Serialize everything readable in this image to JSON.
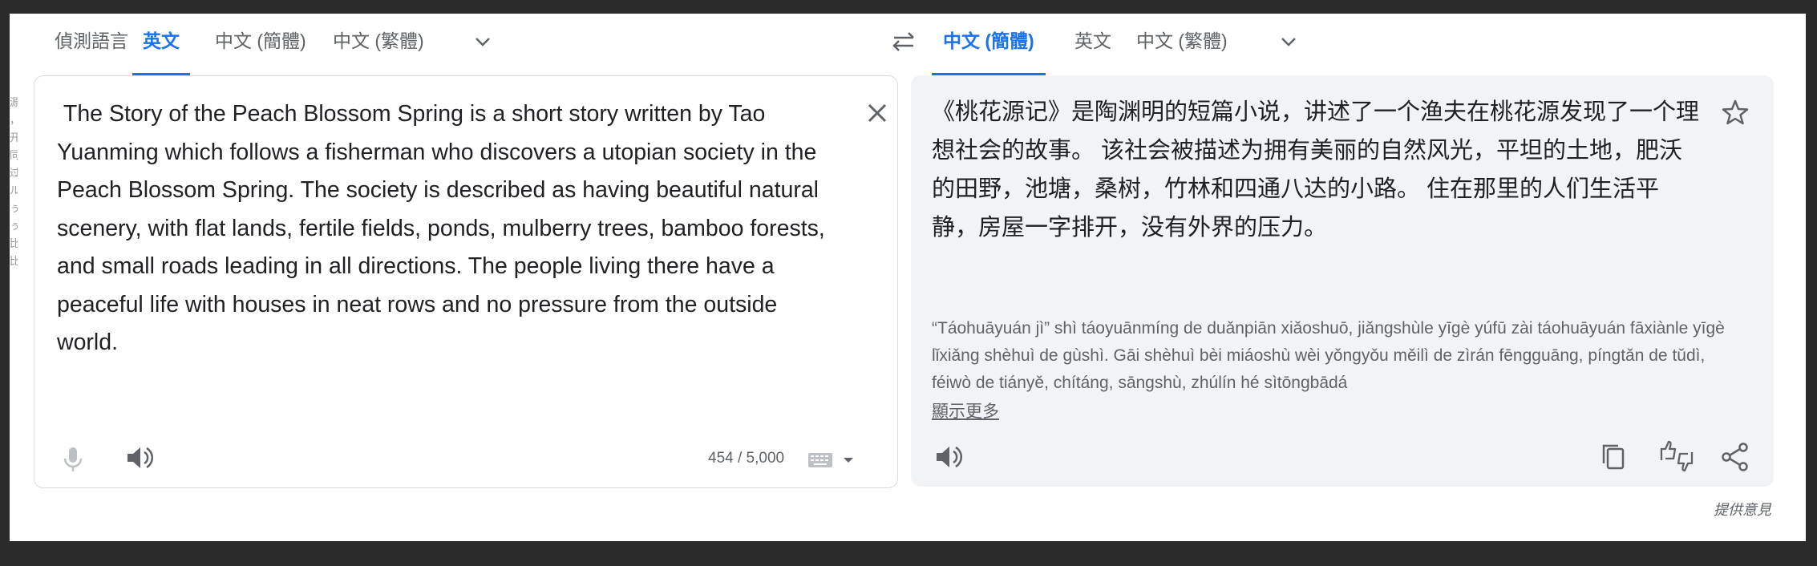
{
  "edge_left_text": "源 ， 开 同 过 ル ぅ ぅ 比 比",
  "source_tabs": [
    {
      "label": "偵測語言",
      "active": false
    },
    {
      "label": "英文",
      "active": true
    },
    {
      "label": "中文 (簡體)",
      "active": false
    },
    {
      "label": "中文 (繁體)",
      "active": false
    }
  ],
  "target_tabs": [
    {
      "label": "中文 (簡體)",
      "active": true
    },
    {
      "label": "英文",
      "active": false
    },
    {
      "label": "中文 (繁體)",
      "active": false
    }
  ],
  "source": {
    "text": " The Story of the Peach Blossom Spring is a short story written by Tao Yuanming which follows a fisherman who discovers a utopian society in the Peach Blossom Spring. The society is described as having beautiful natural scenery, with flat lands, fertile fields, ponds, mulberry trees, bamboo forests, and small roads leading in all directions. The people living there have a peaceful life with houses in neat rows and no pressure from the outside world.",
    "char_count": "454 / 5,000"
  },
  "target": {
    "text": "《桃花源记》是陶渊明的短篇小说，讲述了一个渔夫在桃花源发现了一个理想社会的故事。 该社会被描述为拥有美丽的自然风光，平坦的土地，肥沃的田野，池塘，桑树，竹林和四通八达的小路。 住在那里的人们生活平静，房屋一字排开，没有外界的压力。",
    "transliteration": "“Táohuāyuán jì” shì táoyuānmíng de duǎnpiān xiǎoshuō, jiǎngshùle yīgè yúfū zài táohuāyuán fāxiànle yīgè lǐxiǎng shèhuì de gùshì. Gāi shèhuì bèi miáoshù wèi yǒngyǒu měilì de zìrán fēngguāng, píngtǎn de tǔdì, féiwò de tiányě, chítáng, sāngshù, zhúlín hé sìtōngbādá",
    "show_more": "顯示更多"
  },
  "feedback": "提供意見",
  "colors": {
    "accent": "#1a73e8",
    "text": "#202124",
    "muted": "#5f6368",
    "target_bg": "#f1f3f4"
  }
}
